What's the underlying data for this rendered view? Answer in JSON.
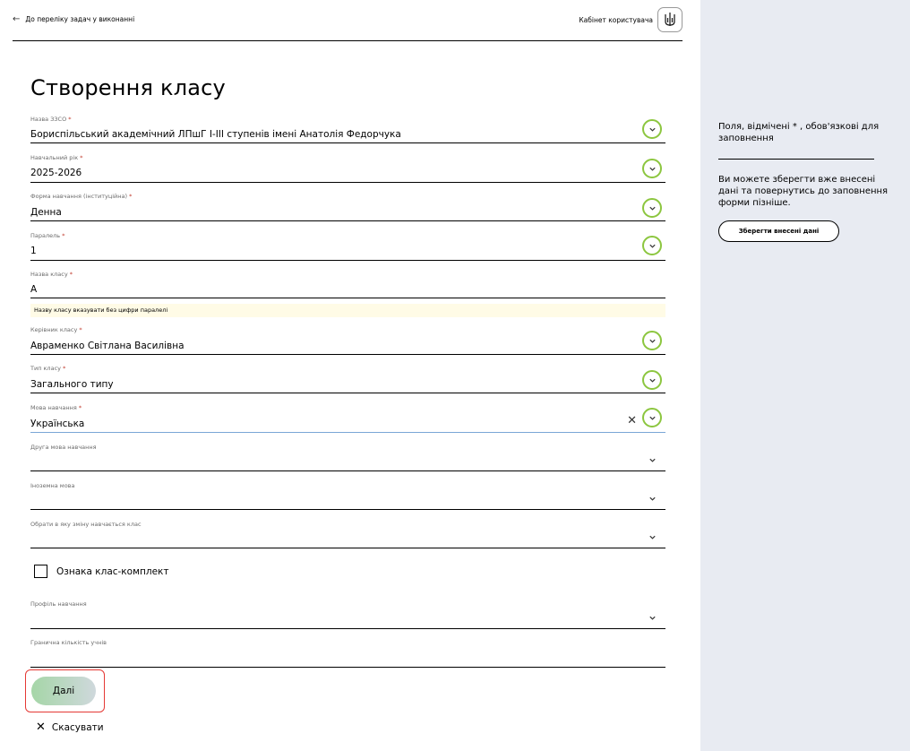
{
  "topbar": {
    "back_label": "До переліку задач у виконанні",
    "cabinet_label": "Кабінет користувача"
  },
  "page_title": "Створення класу",
  "fields": [
    {
      "label": "Назва ЗЗСО",
      "required": "*",
      "value": "Бориспільський академічний ЛПшГ І-ІІІ ступенів імені Анатолія Федорчука"
    },
    {
      "label": "Навчальний рік",
      "required": "*",
      "value": "2025-2026"
    },
    {
      "label": "Форма навчання (інституційна)",
      "required": "*",
      "value": "Денна"
    },
    {
      "label": "Паралель",
      "required": "*",
      "value": "1"
    },
    {
      "label": "Назва класу",
      "required": "*",
      "value": "А"
    },
    {
      "label": "Керівник класу",
      "required": "*",
      "value": "Авраменко Світлана Василівна"
    },
    {
      "label": "Тип класу",
      "required": "*",
      "value": "Загального типу"
    },
    {
      "label": "Мова навчання",
      "required": "*",
      "value": "Українська"
    },
    {
      "label": "Друга мова навчання",
      "required": "",
      "value": ""
    },
    {
      "label": "Іноземна мова",
      "required": "",
      "value": ""
    },
    {
      "label": "Обрати в яку зміну навчається клас",
      "required": "",
      "value": ""
    },
    {
      "label": "Профіль навчання",
      "required": "",
      "value": ""
    },
    {
      "label": "Гранична кількість учнів",
      "required": "",
      "value": ""
    }
  ],
  "hint_text": "Назву класу вказувати без цифри паралелі",
  "checkbox_label": "Ознака клас-комплект",
  "next_label": "Далі",
  "cancel_label": "Скасувати",
  "aside": {
    "note": "Поля, відмічені * , обов'язкові для заповнення",
    "note2": "Ви можете зберегти вже внесені дані та повернутись до заповнення форми пізніше.",
    "save_label": "Зберегти внесені дані"
  },
  "colors": {
    "highlight_ring": "#8cc63f",
    "highlight_box": "#e53935",
    "sidebar_bg": "#e8ebf2",
    "hint_bg": "#fffbe6"
  }
}
